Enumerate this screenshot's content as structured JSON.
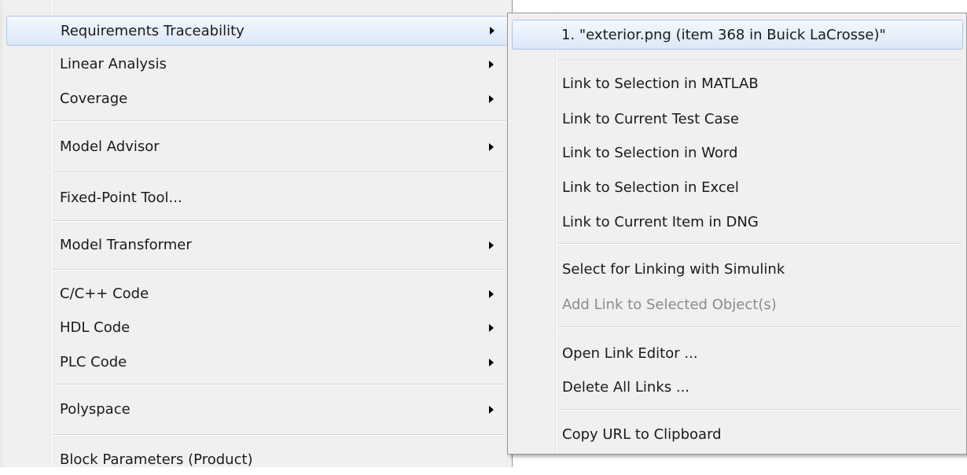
{
  "main_menu": {
    "items": [
      {
        "label": "Requirements Traceability",
        "has_submenu": true,
        "highlighted": true
      },
      {
        "label": "Linear Analysis",
        "has_submenu": true
      },
      {
        "label": "Coverage",
        "has_submenu": true
      },
      {
        "label": "Model Advisor",
        "has_submenu": true
      },
      {
        "label": "Fixed-Point Tool...",
        "has_submenu": false
      },
      {
        "label": "Model Transformer",
        "has_submenu": true
      },
      {
        "label": "C/C++ Code",
        "has_submenu": true
      },
      {
        "label": "HDL Code",
        "has_submenu": true
      },
      {
        "label": "PLC Code",
        "has_submenu": true
      },
      {
        "label": "Polyspace",
        "has_submenu": true
      },
      {
        "label": "Block Parameters (Product)",
        "has_submenu": false
      }
    ]
  },
  "submenu": {
    "items": [
      {
        "label": "1. \"exterior.png (item 368 in Buick LaCrosse)\"",
        "highlighted": true
      },
      {
        "label": "Link to Selection in MATLAB"
      },
      {
        "label": "Link to Current Test Case"
      },
      {
        "label": "Link to Selection in Word"
      },
      {
        "label": "Link to Selection in Excel"
      },
      {
        "label": "Link to Current Item in DNG"
      },
      {
        "label": "Select for Linking with Simulink"
      },
      {
        "label": "Add Link to Selected Object(s)",
        "disabled": true
      },
      {
        "label": "Open Link Editor ..."
      },
      {
        "label": "Delete All Links ..."
      },
      {
        "label": "Copy URL to Clipboard"
      }
    ]
  },
  "colors": {
    "menu_background": "#f0f0f0",
    "highlight_border": "#a9c6ea",
    "disabled_text": "#8b8b8b"
  }
}
